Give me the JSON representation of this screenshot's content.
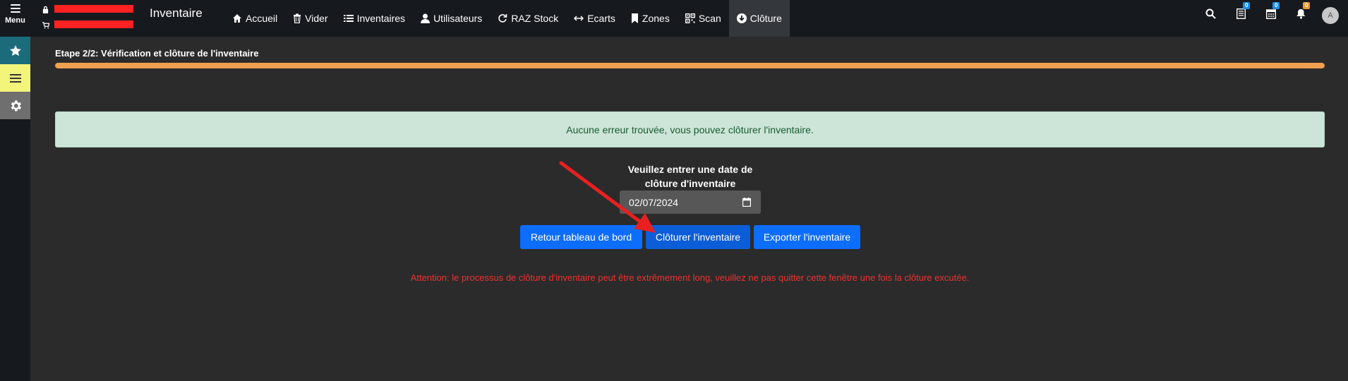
{
  "topbar": {
    "menu_label": "Menu",
    "app_title": "Inventaire",
    "nav": [
      {
        "label": "Accueil",
        "icon": "home-icon"
      },
      {
        "label": "Vider",
        "icon": "trash-icon"
      },
      {
        "label": "Inventaires",
        "icon": "list-icon"
      },
      {
        "label": "Utilisateurs",
        "icon": "user-icon"
      },
      {
        "label": "RAZ Stock",
        "icon": "refresh-icon"
      },
      {
        "label": "Ecarts",
        "icon": "arrows-horizontal-icon"
      },
      {
        "label": "Zones",
        "icon": "bookmark-icon"
      },
      {
        "label": "Scan",
        "icon": "qrcode-icon"
      },
      {
        "label": "Clôture",
        "icon": "circle-arrow-down-icon",
        "active": true
      }
    ],
    "badges": {
      "list": "0",
      "calendar": "0",
      "notifications": "0"
    },
    "avatar_initial": "A"
  },
  "main": {
    "step_title": "Etape 2/2: Vérification et clôture de l'inventaire",
    "progress_percent": 100,
    "alert_text": "Aucune erreur trouvée, vous pouvez clôturer l'inventaire.",
    "date_label_line1": "Veuillez entrer une date de",
    "date_label_line2": "clôture d'inventaire",
    "date_value": "02/07/2024",
    "buttons": {
      "back": "Retour tableau de bord",
      "close": "Clôturer l'inventaire",
      "export": "Exporter l'inventaire"
    },
    "warning": "Attention: le processus de clôture d'inventaire peut être extrêmement long, veuillez ne pas quitter cette fenêtre une fois la clôture excutée."
  },
  "colors": {
    "navbar": "#16191d",
    "background": "#2b2b2b",
    "accent_blue": "#0d6efd",
    "progress": "#f0a050",
    "alert_bg": "#cce5d8",
    "warning_red": "#f03030",
    "annotation_arrow": "#e82020"
  }
}
